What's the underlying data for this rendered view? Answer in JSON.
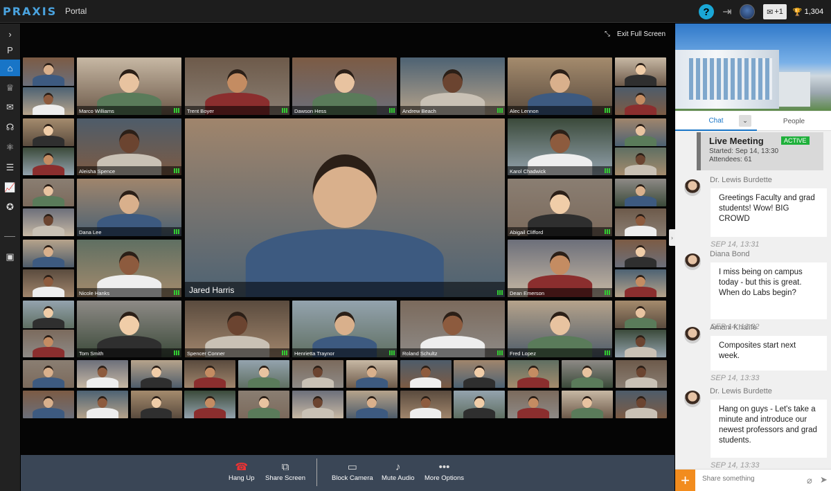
{
  "app": {
    "logo": "PRAXIS",
    "title": "Portal"
  },
  "topbar": {
    "help_icon": "?",
    "exit_icon": "⇥",
    "messages_badge": "+1",
    "trophy_count": "1,304"
  },
  "sidebar": {
    "items": [
      {
        "icon": "chevron-right-icon",
        "glyph": "›"
      },
      {
        "icon": "praxis-p-icon",
        "glyph": "P"
      },
      {
        "icon": "campus-icon",
        "glyph": "⌂"
      },
      {
        "icon": "trophy-icon",
        "glyph": "♕"
      },
      {
        "icon": "mail-icon",
        "glyph": "✉"
      },
      {
        "icon": "planet-icon",
        "glyph": "☊"
      },
      {
        "icon": "atom-icon",
        "glyph": "⚛"
      },
      {
        "icon": "list-icon",
        "glyph": "☰"
      },
      {
        "icon": "chart-icon",
        "glyph": "📈"
      },
      {
        "icon": "medal-icon",
        "glyph": "✪"
      },
      {
        "icon": "contact-card-icon",
        "glyph": "▣"
      }
    ]
  },
  "stage": {
    "exit_fullscreen": "Exit Full Screen",
    "participants": [
      "Marco Williams",
      "Trent Boyer",
      "Dawson Hess",
      "Andrew Beach",
      "Alec Lennon",
      "Aleisha Spence",
      "Karol Chadwick",
      "Dana Lee",
      "Abigail Clifford",
      "Nicole Hanks",
      "Dean Emerson",
      "Tom Smith",
      "Spencer Conner",
      "Henrietta Traynor",
      "Roland Schultz",
      "Fred Lopez"
    ],
    "featured": "Jared Harris"
  },
  "controls": {
    "hang_up": "Hang Up",
    "share_screen": "Share Screen",
    "block_camera": "Block Camera",
    "mute_audio": "Mute Audio",
    "more_options": "More Options"
  },
  "panel": {
    "tabs": {
      "chat": "Chat",
      "people": "People"
    },
    "live": {
      "title": "Live Meeting",
      "status": "ACTIVE",
      "started": "Started: Sep 14, 13:30",
      "attendees": "Attendees: 61"
    },
    "messages": [
      {
        "who": "Dr. Lewis Burdette",
        "text": "Greetings Faculty and grad students! Wow! BIG CROWD",
        "time": "SEP 14, 13:31"
      },
      {
        "who": "Diana Bond",
        "text": "I miss being on campus today -  but this is great. When do Labs begin?",
        "time": "SEP 14, 13:32"
      },
      {
        "who": "Amani Khalife",
        "text": "Composites start next week.",
        "time": "SEP 14, 13:33"
      },
      {
        "who": "Dr. Lewis Burdette",
        "text": "Hang on guys - Let's take a minute and introduce our newest professors and grad students.",
        "time": "SEP 14, 13:33"
      }
    ],
    "compose_placeholder": "Share something"
  },
  "colors": {
    "accent": "#1875c7",
    "active": "#1fb03b",
    "orange": "#f28c1e",
    "controls_bg": "#3a4656"
  }
}
